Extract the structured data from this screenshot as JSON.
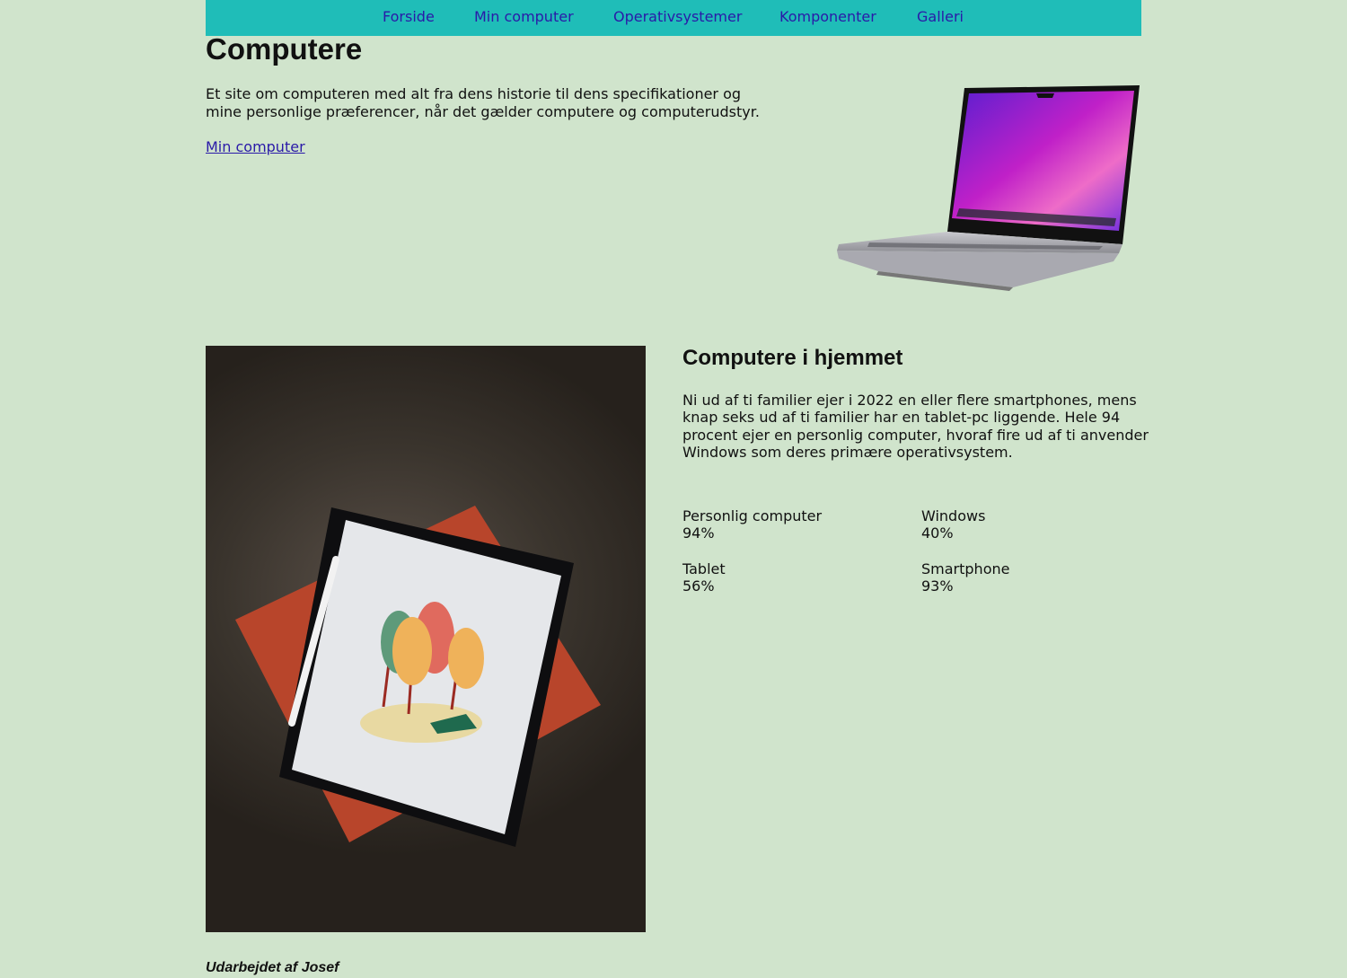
{
  "nav": {
    "items": [
      {
        "label": "Forside"
      },
      {
        "label": "Min computer"
      },
      {
        "label": "Operativsystemer"
      },
      {
        "label": "Komponenter"
      },
      {
        "label": "Galleri"
      }
    ]
  },
  "hero": {
    "title": "Computere",
    "intro": "Et site om computeren med alt fra dens historie til dens specifikationer og mine personlige præferencer, når det gælder computere og computerudstyr.",
    "link_label": "Min computer"
  },
  "home": {
    "heading": "Computere i hjemmet",
    "text": "Ni ud af ti familier ejer i 2022 en eller flere smartphones, mens knap seks ud af ti familier har en tablet-pc liggende. Hele 94 procent ejer en personlig computer, hvoraf fire ud af ti anvender Windows som deres primære operativsystem.",
    "stats": [
      {
        "label": "Personlig computer",
        "value": "94%"
      },
      {
        "label": "Windows",
        "value": "40%"
      },
      {
        "label": "Tablet",
        "value": "56%"
      },
      {
        "label": "Smartphone",
        "value": "93%"
      }
    ]
  },
  "footer": {
    "credit": "Udarbejdet af Josef"
  },
  "colors": {
    "background": "#d0e4cc",
    "nav_background": "#1fbdb8",
    "link": "#2a1aa8"
  }
}
